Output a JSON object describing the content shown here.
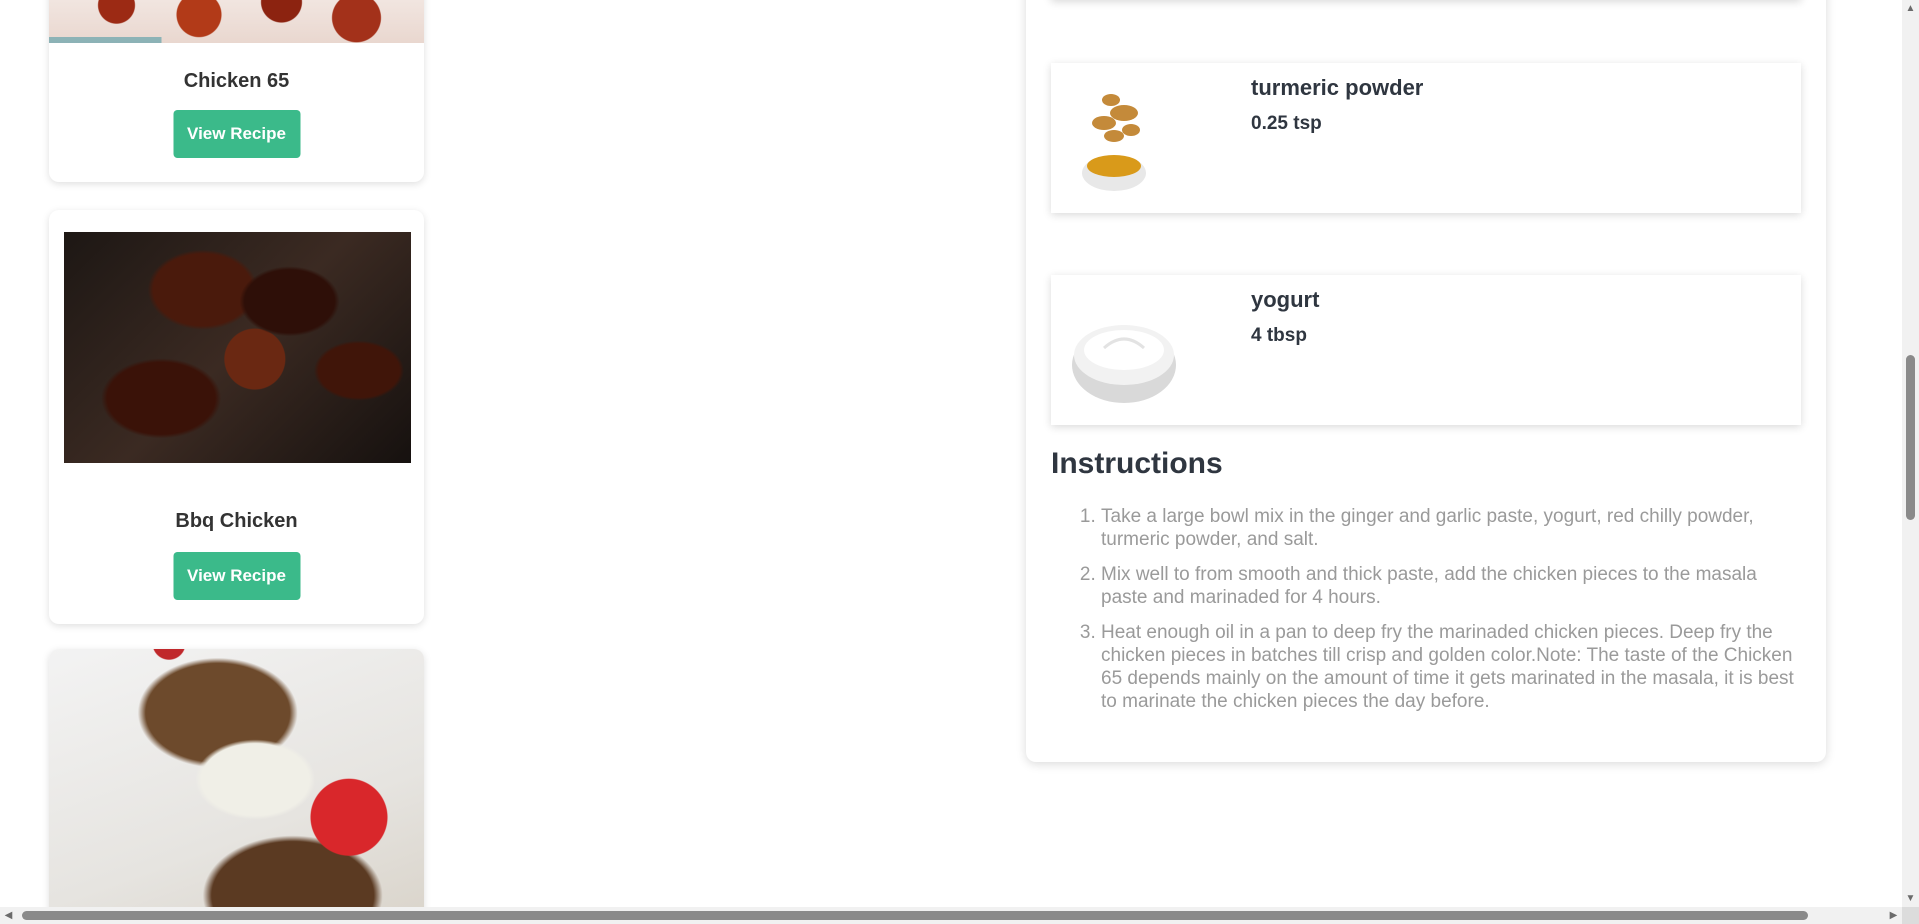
{
  "recipe_cards": [
    {
      "title": "Chicken 65",
      "button_label": "View Recipe"
    },
    {
      "title": "Bbq Chicken",
      "button_label": "View Recipe"
    },
    {
      "title": "",
      "button_label": ""
    }
  ],
  "detail": {
    "ingredients": [
      {
        "name": "turmeric powder",
        "quantity": "0.25 tsp",
        "icon": "turmeric-image"
      },
      {
        "name": "yogurt",
        "quantity": "4 tbsp",
        "icon": "yogurt-image"
      }
    ],
    "instructions_title": "Instructions",
    "steps": [
      "Take a large bowl mix in the ginger and garlic paste, yogurt, red chilly powder, turmeric powder, and salt.",
      "Mix well to from smooth and thick paste, add the chicken pieces to the masala paste and marinaded for 4 hours.",
      "Heat enough oil in a pan to deep fry the marinaded chicken pieces. Deep fry the chicken pieces in batches till crisp and golden color.Note: The taste of the Chicken 65 depends mainly on the amount of time it gets marinated in the masala, it is best to marinate the chicken pieces the day before."
    ]
  },
  "colors": {
    "button_bg": "#3bba8a",
    "heading_text": "#2f3640",
    "step_text": "#9a9a9a"
  },
  "scrollbars": {
    "vertical_arrows": [
      "▲",
      "▼"
    ],
    "horizontal_arrows": [
      "◀",
      "▶"
    ]
  }
}
